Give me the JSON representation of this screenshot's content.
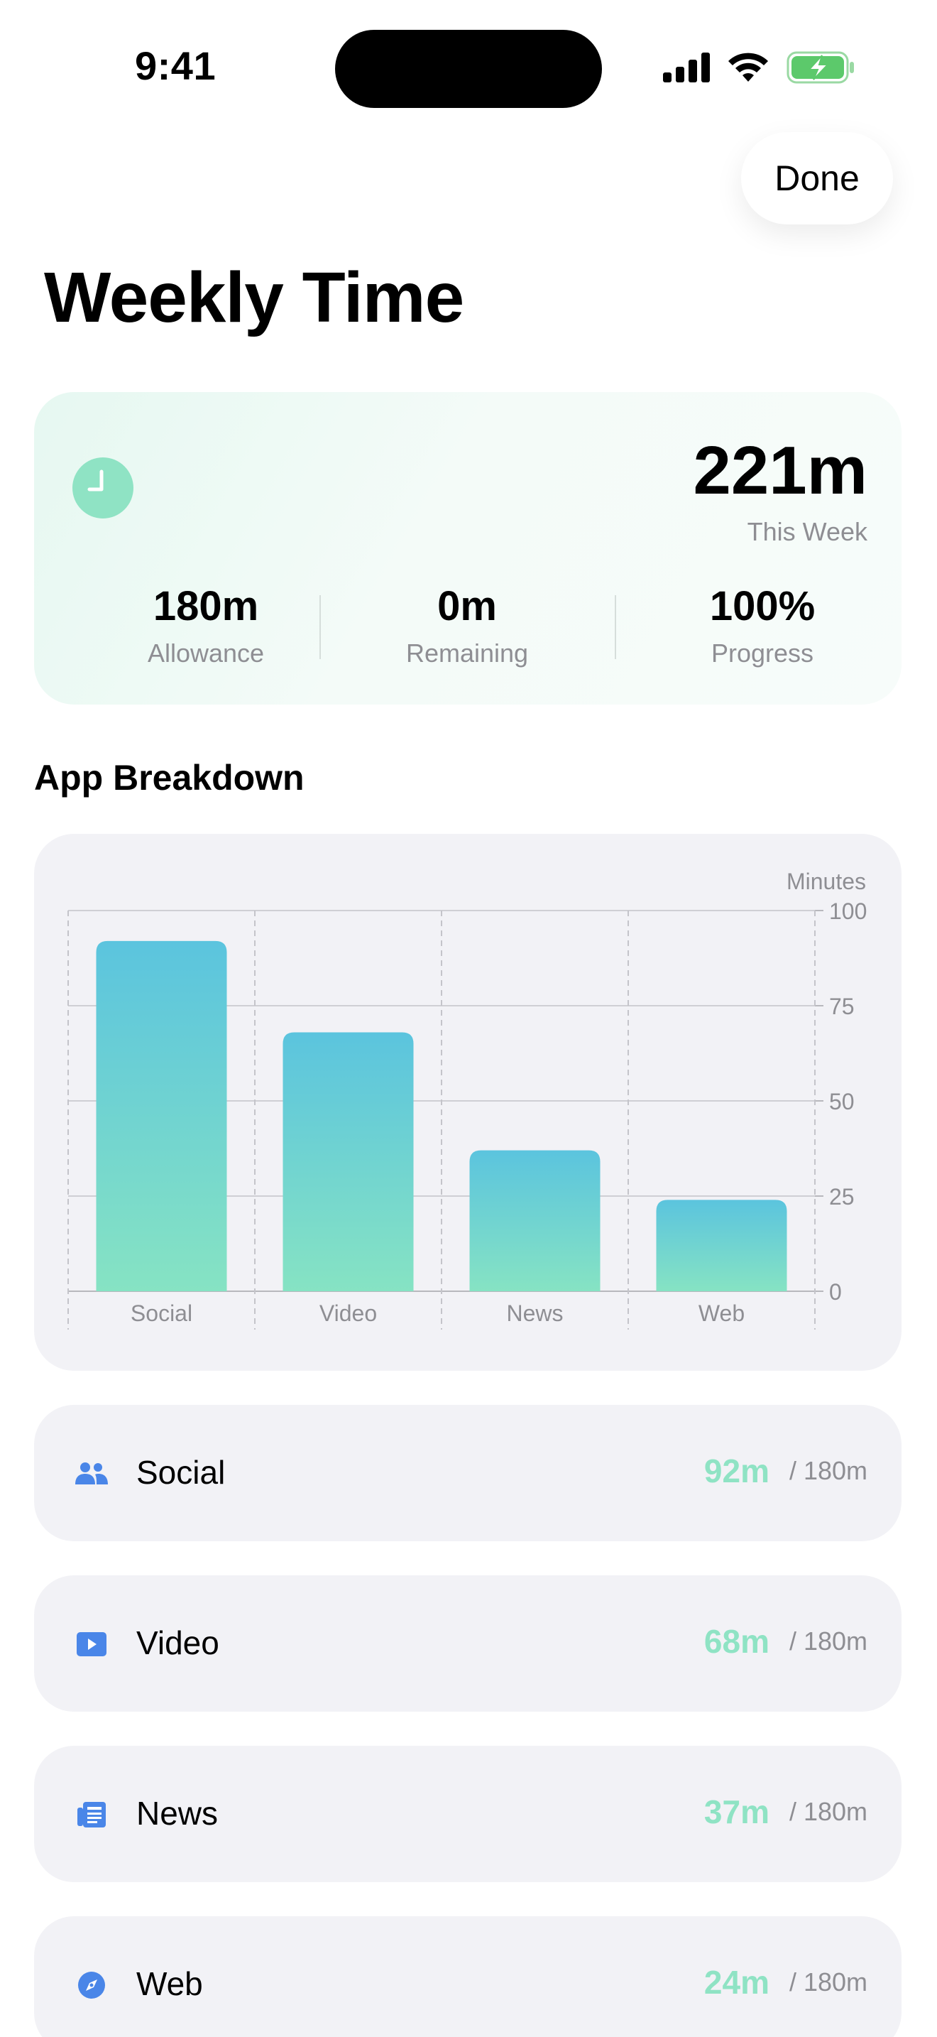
{
  "status_bar": {
    "time": "9:41"
  },
  "header": {
    "done_label": "Done",
    "title": "Weekly Time"
  },
  "summary": {
    "total": "221m",
    "total_caption": "This Week",
    "stats": [
      {
        "value": "180m",
        "label": "Allowance"
      },
      {
        "value": "0m",
        "label": "Remaining"
      },
      {
        "value": "100%",
        "label": "Progress"
      }
    ]
  },
  "section_title": "App Breakdown",
  "colors": {
    "accent": "#8fe3c4",
    "bar_top": "#5bc4de",
    "bar_bottom": "#86e3c3",
    "icon_blue": "#4a86e8"
  },
  "chart_data": {
    "type": "bar",
    "categories": [
      "Social",
      "Video",
      "News",
      "Web"
    ],
    "values": [
      92,
      68,
      37,
      24
    ],
    "ylabel": "Minutes",
    "ylim": [
      0,
      100
    ],
    "yticks": [
      0,
      25,
      50,
      75,
      100
    ],
    "y_axis_position": "right",
    "grid": true
  },
  "apps": [
    {
      "name": "Social",
      "used": "92m",
      "limit": "/ 180m",
      "icon": "people-icon"
    },
    {
      "name": "Video",
      "used": "68m",
      "limit": "/ 180m",
      "icon": "play-icon"
    },
    {
      "name": "News",
      "used": "37m",
      "limit": "/ 180m",
      "icon": "newspaper-icon"
    },
    {
      "name": "Web",
      "used": "24m",
      "limit": "/ 180m",
      "icon": "compass-icon"
    }
  ]
}
